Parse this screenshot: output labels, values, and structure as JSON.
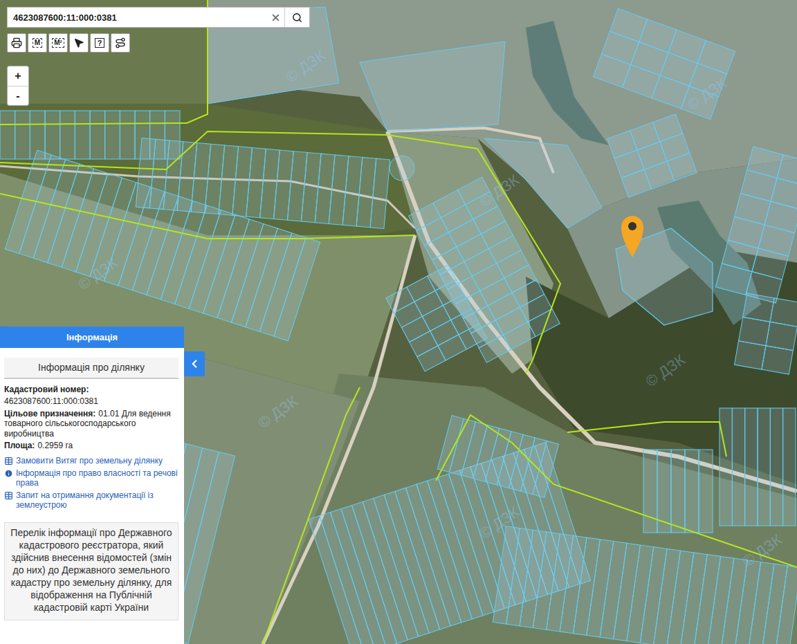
{
  "search": {
    "value": "4623087600:11:000:0381"
  },
  "toolbar": [
    {
      "kind": "print"
    },
    {
      "kind": "measure-line",
      "label": "M"
    },
    {
      "kind": "measure-area",
      "label": "M²"
    },
    {
      "kind": "select"
    },
    {
      "kind": "help",
      "label": "?"
    },
    {
      "kind": "route"
    }
  ],
  "zoom": [
    {
      "label": "+"
    },
    {
      "label": "-"
    }
  ],
  "map": {
    "watermark": "© ДЗК"
  },
  "info_panel": {
    "title": "Інформація",
    "section_title": "Інформація про ділянку",
    "fields": [
      {
        "label": "Кадастровий номер:",
        "value": "4623087600:11:000:0381",
        "kind": "stacked"
      },
      {
        "label": "Цільове призначення:",
        "value": "01.01 Для ведення товарного сільськогосподарського виробництва",
        "kind": "inline"
      },
      {
        "label": "Площа:",
        "value": "0.2959 га",
        "kind": "inline"
      }
    ],
    "links": [
      {
        "label": "Замовити Витяг про земельну ділянку",
        "kind": "table"
      },
      {
        "label": "Інформація про право власності та речові права",
        "kind": "info"
      },
      {
        "label": "Запит на отримання документації із землеустрою",
        "kind": "table"
      }
    ],
    "note": "Перелік інформації про Державного кадастрового реєстратора, який здійснив внесення відомостей (змін до них) до Державного земельного кадастру про земельну ділянку, для відображення на Публічній кадастровій карті України"
  }
}
